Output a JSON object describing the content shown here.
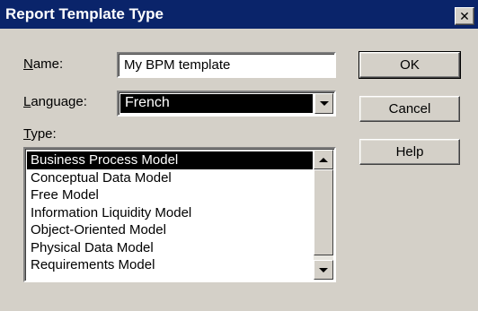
{
  "window": {
    "title": "Report Template Type",
    "close_glyph": "✕"
  },
  "form": {
    "name_label_accel": "N",
    "name_label_rest": "ame:",
    "name_value": "My BPM template",
    "language_label_accel": "L",
    "language_label_rest": "anguage:",
    "language_value": "French",
    "type_label_accel": "T",
    "type_label_rest": "ype:"
  },
  "type_list": {
    "items": [
      "Business Process Model",
      "Conceptual Data Model",
      "Free Model",
      "Information Liquidity Model",
      "Object-Oriented Model",
      "Physical Data Model",
      "Requirements Model"
    ],
    "selected_index": 0
  },
  "buttons": {
    "ok": "OK",
    "cancel": "Cancel",
    "help": "Help"
  },
  "icons": [
    "close-icon",
    "dropdown-arrow-icon",
    "scroll-up-icon",
    "scroll-down-icon"
  ],
  "colors": {
    "titlebar": "#0a246a",
    "dialog_bg": "#d4d0c8",
    "selection": "#000000"
  }
}
